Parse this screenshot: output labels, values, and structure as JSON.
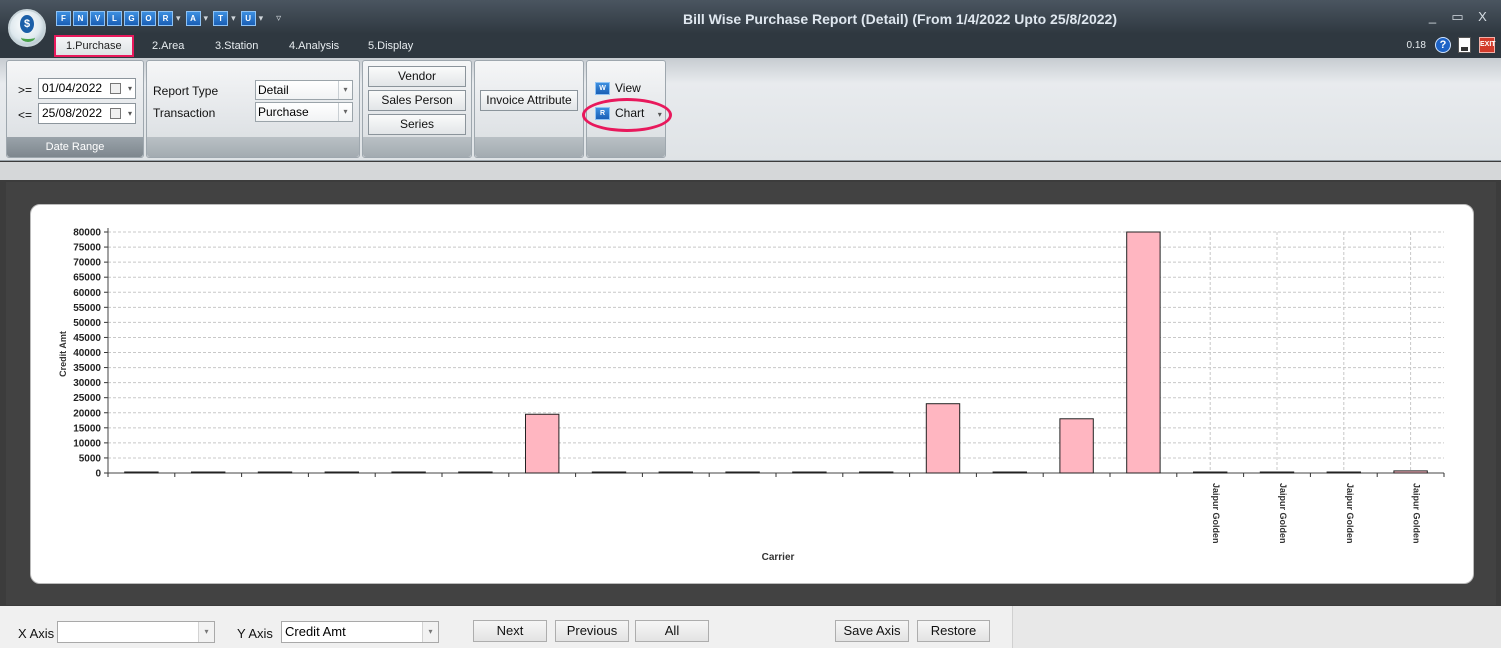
{
  "window": {
    "title": "Bill Wise Purchase Report (Detail) (From 1/4/2022 Upto 25/8/2022)",
    "controls": [
      "_",
      "▭",
      "X"
    ]
  },
  "quick_access": [
    {
      "label": "F",
      "dropdown": false
    },
    {
      "label": "N",
      "dropdown": false
    },
    {
      "label": "V",
      "dropdown": false
    },
    {
      "label": "L",
      "dropdown": false
    },
    {
      "label": "G",
      "dropdown": false
    },
    {
      "label": "O",
      "dropdown": false
    },
    {
      "label": "R",
      "dropdown": true
    },
    {
      "label": "A",
      "dropdown": true
    },
    {
      "label": "T",
      "dropdown": true
    },
    {
      "label": "U",
      "dropdown": true
    }
  ],
  "quick_access_overflow": "▿",
  "tabs": [
    {
      "label": "1.Purchase",
      "active": true
    },
    {
      "label": "2.Area",
      "active": false
    },
    {
      "label": "3.Station",
      "active": false
    },
    {
      "label": "4.Analysis",
      "active": false
    },
    {
      "label": "5.Display",
      "active": false
    }
  ],
  "status": {
    "zoom": "0.18",
    "help_glyph": "?",
    "exit_glyph": "EXIT"
  },
  "ribbon": {
    "date_range": {
      "label": "Date Range",
      "from_op": ">=",
      "from_value": "01/04/2022",
      "to_op": "<=",
      "to_value": "25/08/2022"
    },
    "report": {
      "report_type_label": "Report Type",
      "report_type_value": "Detail",
      "transaction_label": "Transaction",
      "transaction_value": "Purchase"
    },
    "filters": {
      "vendor": "Vendor",
      "sales_person": "Sales Person",
      "series": "Series"
    },
    "invoice_attribute": "Invoice Attribute",
    "view_group": {
      "view_label": "View",
      "view_icon": "W",
      "chart_label": "Chart",
      "chart_icon": "R",
      "chart_dropdown": "▾"
    }
  },
  "chart_data": {
    "type": "bar",
    "xlabel": "Carrier",
    "ylabel": "Credit Amt",
    "ylim": [
      0,
      80000
    ],
    "yticks": [
      0,
      5000,
      10000,
      15000,
      20000,
      25000,
      30000,
      35000,
      40000,
      45000,
      50000,
      55000,
      60000,
      65000,
      70000,
      75000,
      80000
    ],
    "grid": true,
    "categories": [
      "",
      "",
      "",
      "",
      "",
      "",
      "",
      "",
      "",
      "",
      "",
      "",
      "",
      "",
      "",
      "",
      "Jaipur Golden",
      "Jaipur Golden",
      "Jaipur Golden",
      "Jaipur Golden"
    ],
    "values": [
      0,
      0,
      0,
      0,
      0,
      0,
      19500,
      0,
      0,
      0,
      0,
      0,
      23000,
      0,
      18000,
      80000,
      0,
      0,
      300,
      700
    ],
    "color": "#ffb6c1"
  },
  "bottom": {
    "x_axis_label": "X Axis",
    "x_axis_value": "",
    "y_axis_label": "Y Axis",
    "y_axis_value": "Credit Amt",
    "next": "Next",
    "previous": "Previous",
    "all": "All",
    "save_axis": "Save Axis",
    "restore": "Restore"
  }
}
